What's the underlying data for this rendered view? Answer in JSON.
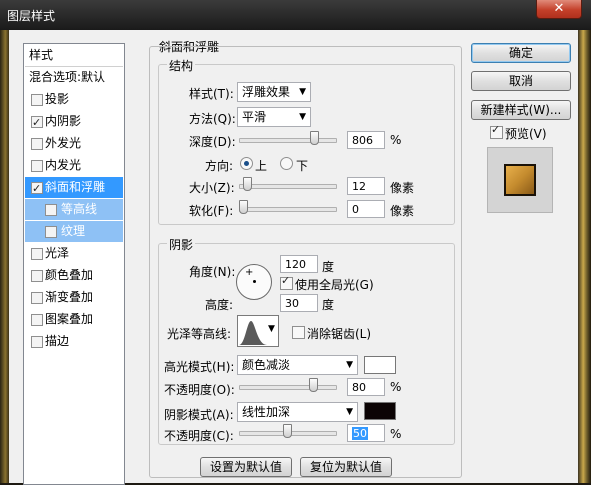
{
  "window": {
    "title": "图层样式",
    "close_glyph": "✕"
  },
  "styles_list": {
    "header": "样式",
    "items": [
      {
        "label": "混合选项:默认",
        "checkbox": false,
        "checked": false
      },
      {
        "label": "投影",
        "checkbox": true,
        "checked": false
      },
      {
        "label": "内阴影",
        "checkbox": true,
        "checked": true
      },
      {
        "label": "外发光",
        "checkbox": true,
        "checked": false
      },
      {
        "label": "内发光",
        "checkbox": true,
        "checked": false
      },
      {
        "label": "斜面和浮雕",
        "checkbox": true,
        "checked": true,
        "selected": true
      },
      {
        "label": "等高线",
        "checkbox": true,
        "checked": false,
        "sub": true
      },
      {
        "label": "纹理",
        "checkbox": true,
        "checked": false,
        "sub": true
      },
      {
        "label": "光泽",
        "checkbox": true,
        "checked": false
      },
      {
        "label": "颜色叠加",
        "checkbox": true,
        "checked": false
      },
      {
        "label": "渐变叠加",
        "checkbox": true,
        "checked": false
      },
      {
        "label": "图案叠加",
        "checkbox": true,
        "checked": false
      },
      {
        "label": "描边",
        "checkbox": true,
        "checked": false
      }
    ]
  },
  "bevel": {
    "section_title": "斜面和浮雕",
    "structure": {
      "title": "结构",
      "style_label": "样式(T):",
      "style_value": "浮雕效果",
      "technique_label": "方法(Q):",
      "technique_value": "平滑",
      "depth_label": "深度(D):",
      "depth_value": "806",
      "depth_unit": "%",
      "depth_slider": 0.81,
      "direction_label": "方向:",
      "dir_up": "上",
      "dir_down": "下",
      "direction_selected": "上",
      "size_label": "大小(Z):",
      "size_value": "12",
      "size_unit": "像素",
      "size_slider": 0.05,
      "soften_label": "软化(F):",
      "soften_value": "0",
      "soften_unit": "像素",
      "soften_slider": 0.0
    },
    "shading": {
      "title": "阴影",
      "angle_label": "角度(N):",
      "angle_value": "120",
      "angle_unit": "度",
      "global_light_label": "使用全局光(G)",
      "global_light": true,
      "altitude_label": "高度:",
      "altitude_value": "30",
      "altitude_unit": "度",
      "gloss_label": "光泽等高线:",
      "antialias_label": "消除锯齿(L)",
      "antialias": false,
      "highlight_mode_label": "高光模式(H):",
      "highlight_mode_value": "颜色减淡",
      "highlight_color": "#ffffff",
      "highlight_opacity_label": "不透明度(O):",
      "highlight_opacity_value": "80",
      "highlight_opacity_unit": "%",
      "highlight_opacity_slider": 0.8,
      "shadow_mode_label": "阴影模式(A):",
      "shadow_mode_value": "线性加深",
      "shadow_color": "#0c0405",
      "shadow_opacity_label": "不透明度(C):",
      "shadow_opacity_value": "50",
      "shadow_opacity_unit": "%",
      "shadow_opacity_slider": 0.5
    },
    "make_default": "设置为默认值",
    "reset_default": "复位为默认值"
  },
  "buttons": {
    "ok": "确定",
    "cancel": "取消",
    "new_style": "新建样式(W)...",
    "preview_label": "预览(V)",
    "preview_checked": true
  }
}
